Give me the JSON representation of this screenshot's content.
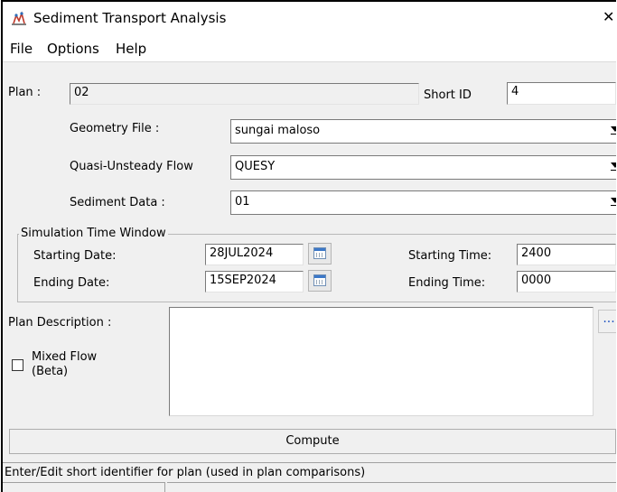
{
  "window": {
    "title": "Sediment Transport Analysis",
    "close_glyph": "✕"
  },
  "menu": {
    "items": [
      "File",
      "Options",
      "Help"
    ]
  },
  "plan": {
    "label": "Plan :",
    "value": "02",
    "short_id_label": "Short ID",
    "short_id_value": "4"
  },
  "geometry": {
    "label": "Geometry File :",
    "value": "sungai maloso"
  },
  "flow": {
    "label": "Quasi-Unsteady Flow",
    "value": "QUESY"
  },
  "sediment": {
    "label": "Sediment Data :",
    "value": "01"
  },
  "time_window": {
    "legend": "Simulation Time Window",
    "start_date_label": "Starting Date:",
    "start_date": "28JUL2024",
    "end_date_label": "Ending Date:",
    "end_date": "15SEP2024",
    "start_time_label": "Starting Time:",
    "start_time": "2400",
    "end_time_label": "Ending Time:",
    "end_time": "0000"
  },
  "description": {
    "label": "Plan Description :",
    "value": "",
    "dots": "..."
  },
  "mixed_flow": {
    "label_line1": "Mixed Flow",
    "label_line2": "(Beta)",
    "checked": false
  },
  "compute_label": "Compute",
  "status": {
    "text": "Enter/Edit short identifier for plan (used in plan comparisons)"
  }
}
